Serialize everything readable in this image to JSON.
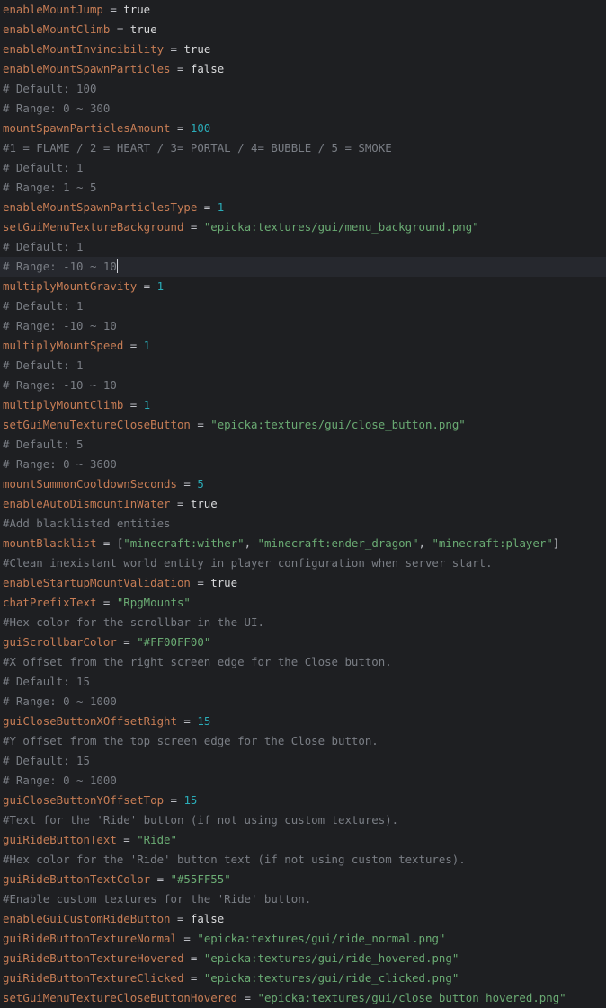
{
  "editor": {
    "current_line": 13,
    "caret_after_line_text": "# Range: -10 ~ 10",
    "lines": [
      {
        "type": "assign",
        "key": "enableMountJump",
        "value": "true",
        "vtype": "bool"
      },
      {
        "type": "assign",
        "key": "enableMountClimb",
        "value": "true",
        "vtype": "bool"
      },
      {
        "type": "assign",
        "key": "enableMountInvincibility",
        "value": "true",
        "vtype": "bool"
      },
      {
        "type": "assign",
        "key": "enableMountSpawnParticles",
        "value": "false",
        "vtype": "bool"
      },
      {
        "type": "comment",
        "text": "# Default: 100"
      },
      {
        "type": "comment",
        "text": "# Range: 0 ~ 300"
      },
      {
        "type": "assign",
        "key": "mountSpawnParticlesAmount",
        "value": "100",
        "vtype": "num"
      },
      {
        "type": "comment",
        "text": "#1 = FLAME / 2 = HEART / 3= PORTAL / 4= BUBBLE / 5 = SMOKE"
      },
      {
        "type": "comment",
        "text": "# Default: 1"
      },
      {
        "type": "comment",
        "text": "# Range: 1 ~ 5"
      },
      {
        "type": "assign",
        "key": "enableMountSpawnParticlesType",
        "value": "1",
        "vtype": "num"
      },
      {
        "type": "assign",
        "key": "setGuiMenuTextureBackground",
        "value": "\"epicka:textures/gui/menu_background.png\"",
        "vtype": "str"
      },
      {
        "type": "comment",
        "text": "# Default: 1"
      },
      {
        "type": "comment",
        "text": "# Range: -10 ~ 10"
      },
      {
        "type": "assign",
        "key": "multiplyMountGravity",
        "value": "1",
        "vtype": "num"
      },
      {
        "type": "comment",
        "text": "# Default: 1"
      },
      {
        "type": "comment",
        "text": "# Range: -10 ~ 10"
      },
      {
        "type": "assign",
        "key": "multiplyMountSpeed",
        "value": "1",
        "vtype": "num"
      },
      {
        "type": "comment",
        "text": "# Default: 1"
      },
      {
        "type": "comment",
        "text": "# Range: -10 ~ 10"
      },
      {
        "type": "assign",
        "key": "multiplyMountClimb",
        "value": "1",
        "vtype": "num"
      },
      {
        "type": "assign",
        "key": "setGuiMenuTextureCloseButton",
        "value": "\"epicka:textures/gui/close_button.png\"",
        "vtype": "str"
      },
      {
        "type": "comment",
        "text": "# Default: 5"
      },
      {
        "type": "comment",
        "text": "# Range: 0 ~ 3600"
      },
      {
        "type": "assign",
        "key": "mountSummonCooldownSeconds",
        "value": "5",
        "vtype": "num"
      },
      {
        "type": "assign",
        "key": "enableAutoDismountInWater",
        "value": "true",
        "vtype": "bool"
      },
      {
        "type": "comment",
        "text": "#Add blacklisted entities"
      },
      {
        "type": "array",
        "key": "mountBlacklist",
        "items": [
          "\"minecraft:wither\"",
          "\"minecraft:ender_dragon\"",
          "\"minecraft:player\""
        ]
      },
      {
        "type": "comment",
        "text": "#Clean inexistant world entity in player configuration when server start."
      },
      {
        "type": "assign",
        "key": "enableStartupMountValidation",
        "value": "true",
        "vtype": "bool"
      },
      {
        "type": "assign",
        "key": "chatPrefixText",
        "value": "\"RpgMounts\"",
        "vtype": "str"
      },
      {
        "type": "comment",
        "text": "#Hex color for the scrollbar in the UI."
      },
      {
        "type": "assign",
        "key": "guiScrollbarColor",
        "value": "\"#FF00FF00\"",
        "vtype": "str"
      },
      {
        "type": "comment",
        "text": "#X offset from the right screen edge for the Close button."
      },
      {
        "type": "comment",
        "text": "# Default: 15"
      },
      {
        "type": "comment",
        "text": "# Range: 0 ~ 1000"
      },
      {
        "type": "assign",
        "key": "guiCloseButtonXOffsetRight",
        "value": "15",
        "vtype": "num"
      },
      {
        "type": "comment",
        "text": "#Y offset from the top screen edge for the Close button."
      },
      {
        "type": "comment",
        "text": "# Default: 15"
      },
      {
        "type": "comment",
        "text": "# Range: 0 ~ 1000"
      },
      {
        "type": "assign",
        "key": "guiCloseButtonYOffsetTop",
        "value": "15",
        "vtype": "num"
      },
      {
        "type": "comment",
        "text": "#Text for the 'Ride' button (if not using custom textures)."
      },
      {
        "type": "assign",
        "key": "guiRideButtonText",
        "value": "\"Ride\"",
        "vtype": "str"
      },
      {
        "type": "comment",
        "text": "#Hex color for the 'Ride' button text (if not using custom textures)."
      },
      {
        "type": "assign",
        "key": "guiRideButtonTextColor",
        "value": "\"#55FF55\"",
        "vtype": "str"
      },
      {
        "type": "comment",
        "text": "#Enable custom textures for the 'Ride' button."
      },
      {
        "type": "assign",
        "key": "enableGuiCustomRideButton",
        "value": "false",
        "vtype": "bool"
      },
      {
        "type": "assign",
        "key": "guiRideButtonTextureNormal",
        "value": "\"epicka:textures/gui/ride_normal.png\"",
        "vtype": "str"
      },
      {
        "type": "assign",
        "key": "guiRideButtonTextureHovered",
        "value": "\"epicka:textures/gui/ride_hovered.png\"",
        "vtype": "str"
      },
      {
        "type": "assign",
        "key": "guiRideButtonTextureClicked",
        "value": "\"epicka:textures/gui/ride_clicked.png\"",
        "vtype": "str"
      },
      {
        "type": "assign",
        "key": "setGuiMenuTextureCloseButtonHovered",
        "value": "\"epicka:textures/gui/close_button_hovered.png\"",
        "vtype": "str"
      }
    ],
    "tokens": {
      "equals": " = ",
      "array_open": "[",
      "array_close": "]",
      "array_sep": ", "
    },
    "colors": {
      "background": "#1e1f22",
      "current_line": "#26282e",
      "key": "#c77d55",
      "string": "#6aab73",
      "number": "#2aacb8",
      "comment": "#7a7e85",
      "text": "#bcbec4"
    }
  }
}
